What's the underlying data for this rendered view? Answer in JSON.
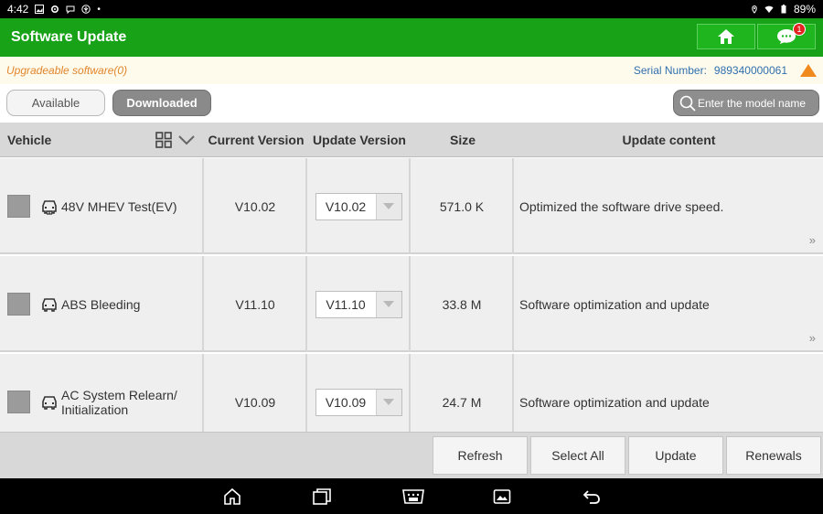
{
  "status_bar": {
    "time": "4:42",
    "battery": "89%"
  },
  "header": {
    "title": "Software Update",
    "message_badge": "1"
  },
  "info": {
    "upgradeable": "Upgradeable software(0)",
    "serial_label": "Serial Number:",
    "serial_value": "989340000061"
  },
  "tabs": {
    "available": "Available",
    "downloaded": "Downloaded"
  },
  "search": {
    "placeholder": "Enter the model name"
  },
  "table": {
    "headers": {
      "vehicle": "Vehicle",
      "current": "Current Version",
      "update": "Update Version",
      "size": "Size",
      "content": "Update content"
    },
    "rows": [
      {
        "vehicle": "48V MHEV Test(EV)",
        "current": "V10.02",
        "update": "V10.02",
        "size": "571.0 K",
        "content": "Optimized the software drive speed."
      },
      {
        "vehicle": "ABS Bleeding",
        "current": "V11.10",
        "update": "V11.10",
        "size": "33.8 M",
        "content": "Software optimization and update"
      },
      {
        "vehicle": "AC System Relearn/ Initialization",
        "current": "V10.09",
        "update": "V10.09",
        "size": "24.7 M",
        "content": "Software optimization and update"
      }
    ]
  },
  "actions": {
    "refresh": "Refresh",
    "select_all": "Select All",
    "update": "Update",
    "renewals": "Renewals"
  },
  "icons": {
    "more": "»"
  },
  "colors": {
    "header_green": "#18a218",
    "upgrade_orange": "#e0852c",
    "serial_blue": "#2f6fae"
  }
}
